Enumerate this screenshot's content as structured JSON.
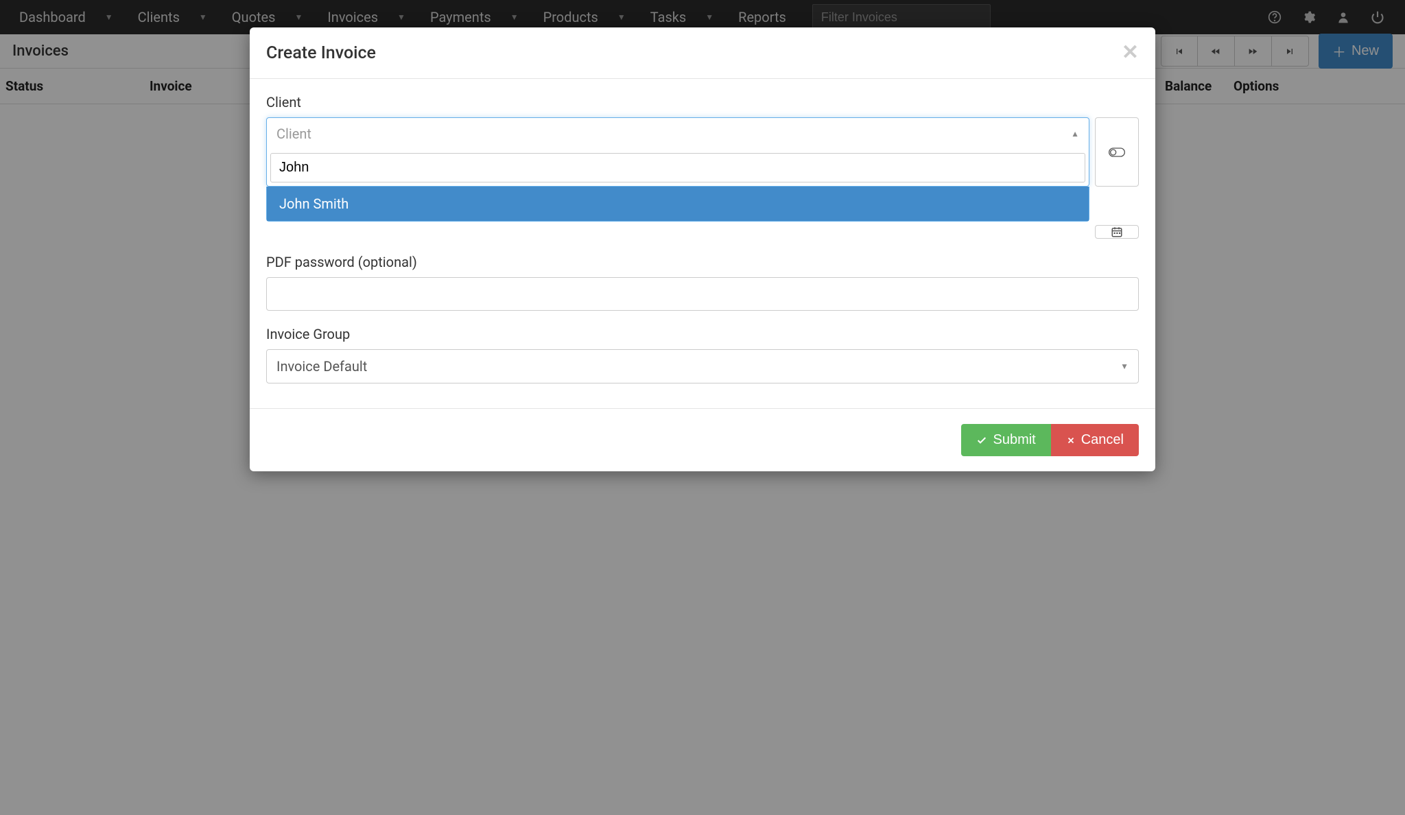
{
  "nav": {
    "items": [
      "Dashboard",
      "Clients",
      "Quotes",
      "Invoices",
      "Payments",
      "Products",
      "Tasks",
      "Reports"
    ],
    "filter_placeholder": "Filter Invoices"
  },
  "subheader": {
    "title": "Invoices",
    "new_label": "New"
  },
  "table": {
    "columns": {
      "status": "Status",
      "invoice": "Invoice",
      "balance": "Balance",
      "options": "Options"
    }
  },
  "modal": {
    "title": "Create Invoice",
    "client_label": "Client",
    "client_placeholder": "Client",
    "client_search_value": "John",
    "client_option": "John Smith",
    "pdf_label": "PDF password (optional)",
    "group_label": "Invoice Group",
    "group_selected": "Invoice Default",
    "submit_label": "Submit",
    "cancel_label": "Cancel"
  }
}
